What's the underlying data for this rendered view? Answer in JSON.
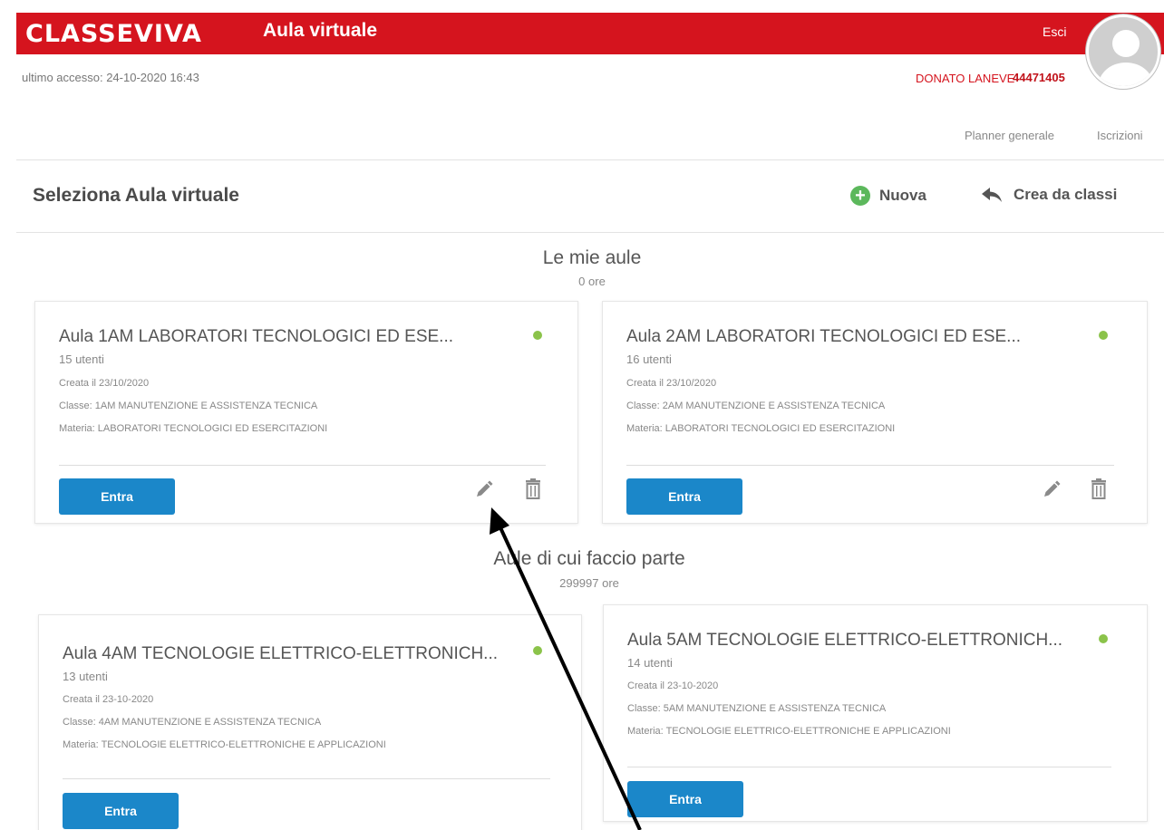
{
  "header": {
    "logo": "CLASSEVIVA",
    "app_title": "Aula virtuale",
    "logout_label": "Esci",
    "last_access": "ultimo accesso: 24-10-2020 16:43",
    "user_name": "DONATO LANEVE",
    "user_code": "44471405",
    "brand_color": "#d5141e"
  },
  "topnav": {
    "planner": "Planner generale",
    "iscrizioni": "Iscrizioni"
  },
  "section": {
    "title": "Seleziona Aula virtuale",
    "new_label": "Nuova",
    "create_from_classes_label": "Crea da classi"
  },
  "my_classrooms": {
    "title": "Le mie aule",
    "hours": "0 ore",
    "cards": [
      {
        "title": "Aula 1AM LABORATORI TECNOLOGICI ED ESE...",
        "users": "15 utenti",
        "created": "Creata il 23/10/2020",
        "class": "Classe: 1AM MANUTENZIONE E ASSISTENZA TECNICA",
        "subject": "Materia: LABORATORI TECNOLOGICI ED ESERCITAZIONI",
        "enter_label": "Entra"
      },
      {
        "title": "Aula 2AM LABORATORI TECNOLOGICI ED ESE...",
        "users": "16 utenti",
        "created": "Creata il 23/10/2020",
        "class": "Classe: 2AM MANUTENZIONE E ASSISTENZA TECNICA",
        "subject": "Materia: LABORATORI TECNOLOGICI ED ESERCITAZIONI",
        "enter_label": "Entra"
      }
    ]
  },
  "member_classrooms": {
    "title": "Aule di cui faccio parte",
    "hours": "299997 ore",
    "cards": [
      {
        "title": "Aula 4AM TECNOLOGIE ELETTRICO-ELETTRONICH...",
        "users": "13 utenti",
        "created": "Creata il 23-10-2020",
        "class": "Classe: 4AM MANUTENZIONE E ASSISTENZA TECNICA",
        "subject": "Materia: TECNOLOGIE ELETTRICO-ELETTRONICHE E APPLICAZIONI",
        "enter_label": "Entra"
      },
      {
        "title": "Aula 5AM TECNOLOGIE ELETTRICO-ELETTRONICH...",
        "users": "14 utenti",
        "created": "Creata il 23-10-2020",
        "class": "Classe: 5AM MANUTENZIONE E ASSISTENZA TECNICA",
        "subject": "Materia: TECNOLOGIE ELETTRICO-ELETTRONICHE E APPLICAZIONI",
        "enter_label": "Entra"
      }
    ]
  },
  "icons": {
    "add": "plus-circle-icon",
    "create_from": "reply-arrow-icon",
    "edit": "pencil-icon",
    "delete": "trash-icon",
    "status": "status-dot-icon"
  },
  "colors": {
    "enter_button": "#1b87c9",
    "status_active": "#8bc34a",
    "add_icon": "#5cb85c"
  }
}
